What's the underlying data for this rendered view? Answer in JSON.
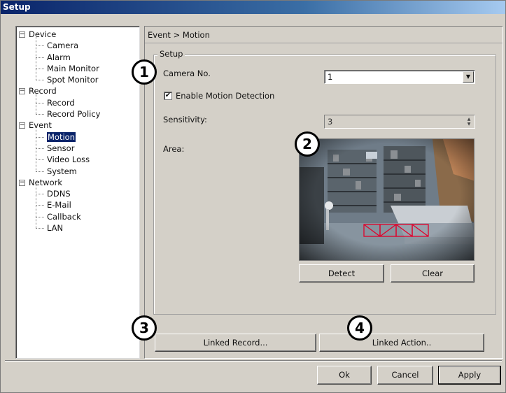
{
  "window": {
    "title": "Setup"
  },
  "tree": [
    {
      "label": "Device",
      "children": [
        "Camera",
        "Alarm",
        "Main Monitor",
        "Spot Monitor"
      ]
    },
    {
      "label": "Record",
      "children": [
        "Record",
        "Record Policy"
      ]
    },
    {
      "label": "Event",
      "children": [
        "Motion",
        "Sensor",
        "Video Loss",
        "System"
      ],
      "selected_child": "Motion"
    },
    {
      "label": "Network",
      "children": [
        "DDNS",
        "E-Mail",
        "Callback",
        "LAN"
      ]
    }
  ],
  "tree_toggle_glyph": "−",
  "breadcrumb": "Event > Motion",
  "setup": {
    "legend": "Setup",
    "camera_label": "Camera No.",
    "camera_value": "1",
    "enable_label": "Enable Motion Detection",
    "enable_checked": true,
    "check_glyph": "✔",
    "sensitivity_label": "Sensitivity:",
    "sensitivity_value": "3",
    "area_label": "Area:"
  },
  "buttons": {
    "detect": "Detect",
    "clear": "Clear",
    "linked_record": "Linked Record...",
    "linked_action": "Linked Action..",
    "ok": "Ok",
    "cancel": "Cancel",
    "apply": "Apply"
  },
  "callouts": [
    "1",
    "2",
    "3",
    "4"
  ],
  "icons": {
    "dropdown": "chevron-down-icon",
    "spin": "spinner-icon"
  },
  "colors": {
    "title_bar": "#0a246a",
    "selection": "#0a246a",
    "motion_grid": "#e0002a",
    "dialog_bg": "#d4d0c8"
  }
}
